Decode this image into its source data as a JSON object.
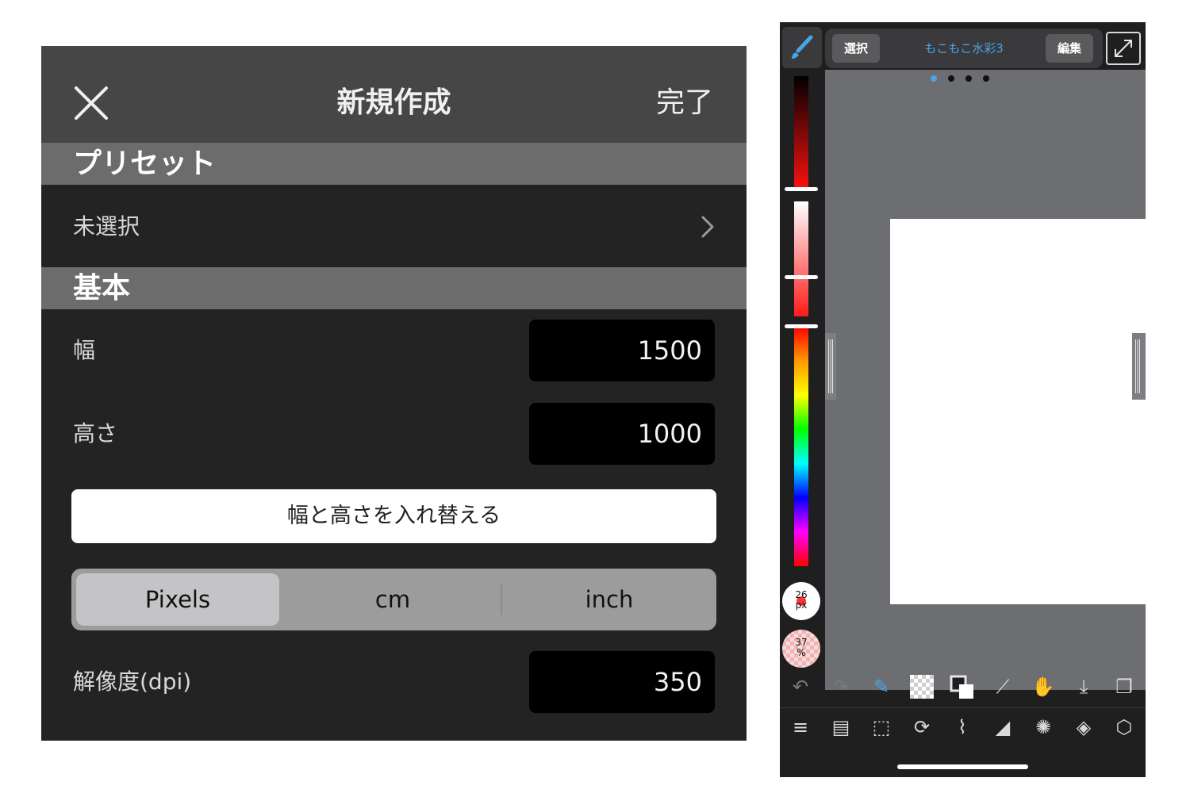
{
  "dialog": {
    "title": "新規作成",
    "done_label": "完了",
    "preset_section": "プリセット",
    "preset_value": "未選択",
    "basic_section": "基本",
    "width_label": "幅",
    "width_value": "1500",
    "height_label": "高さ",
    "height_value": "1000",
    "swap_button": "幅と高さを入れ替える",
    "units": [
      {
        "label": "Pixels",
        "selected": true
      },
      {
        "label": "cm",
        "selected": false
      },
      {
        "label": "inch",
        "selected": false
      }
    ],
    "dpi_label": "解像度(dpi)",
    "dpi_value": "350"
  },
  "app": {
    "select_button": "選択",
    "brush_name": "もこもこ水彩3",
    "edit_button": "編集",
    "page_dots": 4,
    "active_dot": 0,
    "brush_size_text": "26\npx",
    "opacity_text": "37\n%",
    "accent_color": "#4aa3e8",
    "current_color": "#ff3333",
    "toolbar_top": [
      "undo-icon",
      "redo-icon",
      "brush-eraser-toggle-icon",
      "transparent-color-icon",
      "fg-bg-color-icon",
      "eyedropper-icon",
      "hand-icon",
      "save-icon",
      "copy-icon"
    ],
    "toolbar_bottom": [
      "menu-icon",
      "pages-icon",
      "selection-icon",
      "rotate-icon",
      "ruler-icon",
      "bucket-icon",
      "palette-icon",
      "layers-icon",
      "materials-icon"
    ]
  }
}
